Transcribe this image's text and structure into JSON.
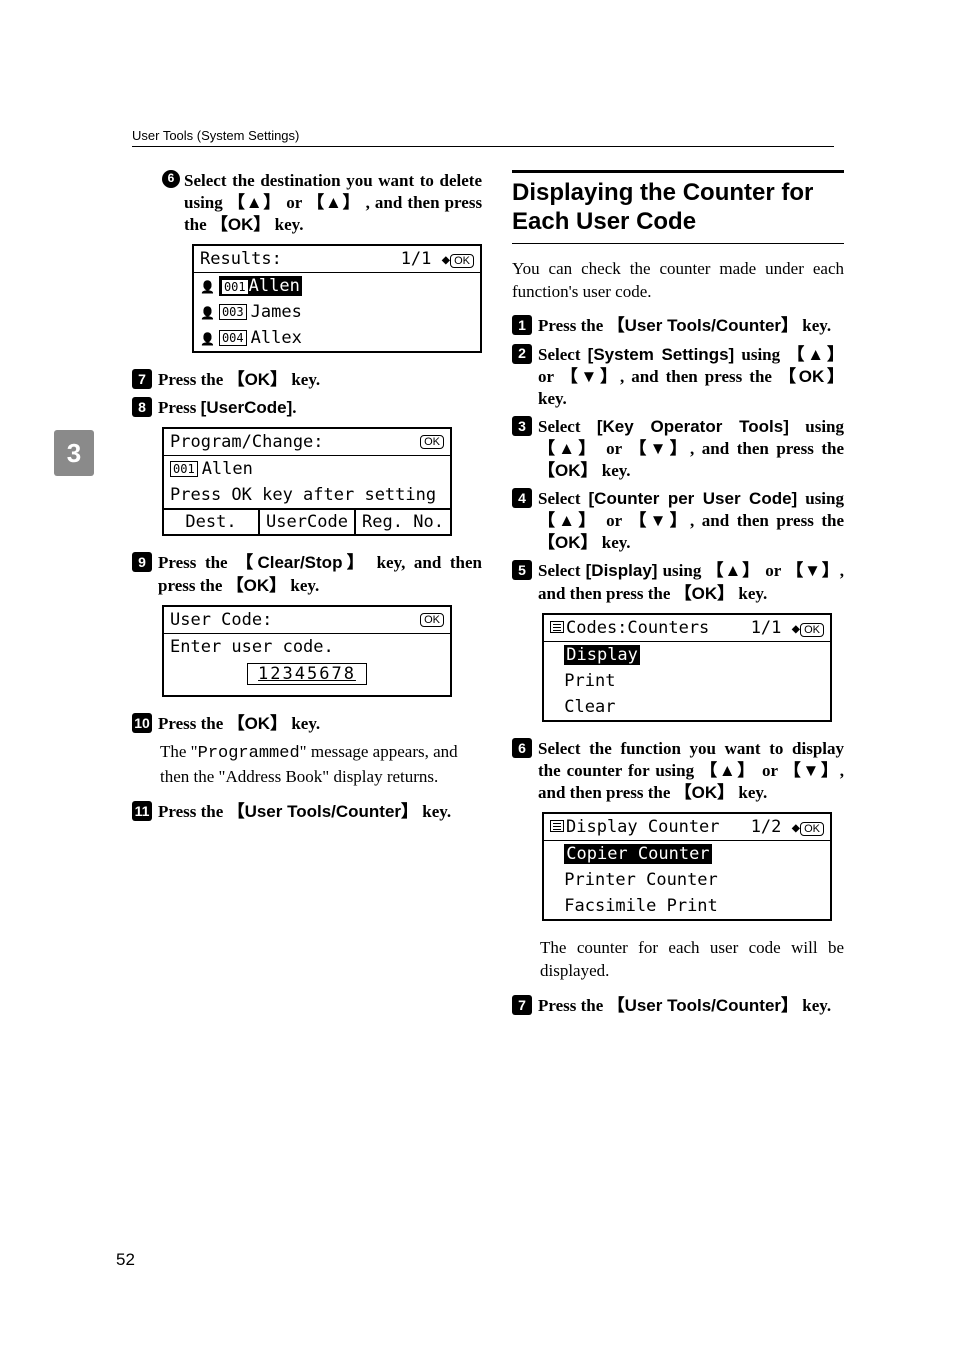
{
  "header": {
    "title": "User Tools (System Settings)"
  },
  "side_tab": "3",
  "page_number": "52",
  "left": {
    "steps": {
      "s6": {
        "num": "6",
        "text_parts": [
          "Select the destination you want to delete using ",
          " or ",
          ", and then press the ",
          " key."
        ],
        "keys": [
          "▲",
          "▲",
          "OK"
        ]
      },
      "lcd1": {
        "header_left": "Results:",
        "header_right": "1/1",
        "rows": [
          {
            "id": "001",
            "name": "Allen",
            "highlight": true
          },
          {
            "id": "003",
            "name": "James",
            "highlight": false
          },
          {
            "id": "004",
            "name": "Allex",
            "highlight": false
          }
        ]
      },
      "s7": {
        "num": "7",
        "text_a": "Press the ",
        "key": "OK",
        "text_b": " key."
      },
      "s8": {
        "num": "8",
        "text_a": "Press ",
        "label": "[UserCode]",
        "text_b": "."
      },
      "lcd2": {
        "header_left": "Program/Change:",
        "row1_id": "001",
        "row1_name": "Allen",
        "row2": "Press OK key after setting",
        "buttons": [
          "Dest.",
          "UserCode",
          "Reg. No."
        ]
      },
      "s9": {
        "num": "9",
        "text_a": "Press the ",
        "key1": "Clear/Stop",
        "text_b": " key, and then press the ",
        "key2": "OK",
        "text_c": " key."
      },
      "lcd3": {
        "header_left": "User Code:",
        "row1": "Enter user code.",
        "input": "12345678"
      },
      "s10": {
        "num": "10",
        "text_a": "Press the ",
        "key": "OK",
        "text_b": " key."
      },
      "body10": "The \"Programmed\" message appears, and then the \"Address Book\" display returns.",
      "body10_code": "Programmed",
      "body10_pre": "The \"",
      "body10_post": "\" message appears, and then the \"Address Book\" display returns.",
      "s11": {
        "num": "11",
        "text_a": "Press the ",
        "key": "User Tools/Counter",
        "text_b": " key."
      }
    }
  },
  "right": {
    "title": "Displaying the Counter for Each User Code",
    "intro": "You can check the counter made under each function's user code.",
    "steps": {
      "r1": {
        "num": "1",
        "text_a": "Press the ",
        "key": "User Tools/Counter",
        "text_b": " key."
      },
      "r2": {
        "num": "2",
        "text_a": "Select ",
        "label": "[System Settings]",
        "text_b": " using ",
        "text_c": " or ",
        "text_d": ", and then press the ",
        "text_e": " key.",
        "k1": "▲",
        "k2": "▼",
        "k3": "OK"
      },
      "r3": {
        "num": "3",
        "text_a": "Select ",
        "label": "[Key Operator Tools]",
        "text_b": " using ",
        "text_c": " or ",
        "text_d": ", and then press the ",
        "text_e": " key.",
        "k1": "▲",
        "k2": "▼",
        "k3": "OK"
      },
      "r4": {
        "num": "4",
        "text_a": "Select ",
        "label": "[Counter per User Code]",
        "text_b": " using ",
        "text_c": " or ",
        "text_d": ", and then press the ",
        "text_e": " key.",
        "k1": "▲",
        "k2": "▼",
        "k3": "OK"
      },
      "r5": {
        "num": "5",
        "text_a": "Select ",
        "label": "[Display]",
        "text_b": " using ",
        "text_c": " or ",
        "text_d": ", and then press the ",
        "text_e": " key.",
        "k1": "▲",
        "k2": "▼",
        "k3": "OK"
      },
      "lcd4": {
        "header_left": "Codes:Counters",
        "header_right": "1/1",
        "rows": [
          {
            "name": "Display",
            "highlight": true
          },
          {
            "name": "Print",
            "highlight": false
          },
          {
            "name": "Clear",
            "highlight": false
          }
        ]
      },
      "r6": {
        "num": "6",
        "text_a": "Select the function you want to display the counter for using ",
        "text_b": " or ",
        "text_c": ", and then press the ",
        "text_d": " key.",
        "k1": "▲",
        "k2": "▼",
        "k3": "OK"
      },
      "lcd5": {
        "header_left": "Display Counter",
        "header_right": "1/2",
        "rows": [
          {
            "name": "Copier Counter",
            "highlight": true
          },
          {
            "name": "Printer Counter",
            "highlight": false
          },
          {
            "name": "Facsimile Print",
            "highlight": false
          }
        ]
      },
      "body6": "The counter for each user code will be displayed.",
      "r7": {
        "num": "7",
        "text_a": "Press the ",
        "key": "User Tools/Counter",
        "text_b": " key."
      }
    }
  }
}
